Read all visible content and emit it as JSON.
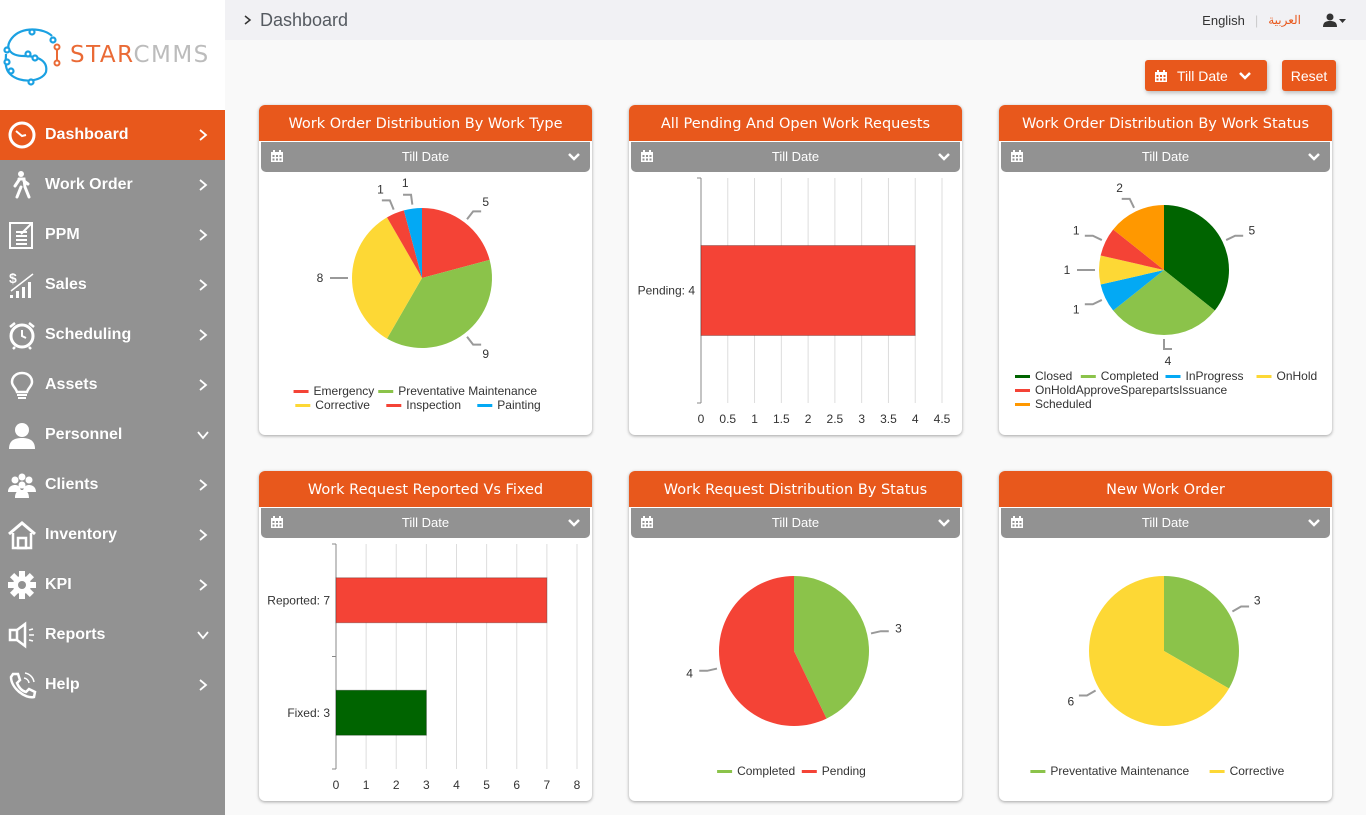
{
  "app": {
    "logo_primary": "STAR",
    "logo_secondary": "CMMS",
    "colors": {
      "brand": "#e8581c",
      "sidebar": "#929292",
      "logo_blue": "#1ba1e2"
    }
  },
  "sidebar": {
    "items": [
      {
        "label": "Dashboard",
        "icon": "clock-icon",
        "chevron": "right",
        "active": true
      },
      {
        "label": "Work Order",
        "icon": "walking-person-icon",
        "chevron": "right"
      },
      {
        "label": "PPM",
        "icon": "checklist-document-icon",
        "chevron": "right"
      },
      {
        "label": "Sales",
        "icon": "dollar-growth-icon",
        "chevron": "right"
      },
      {
        "label": "Scheduling",
        "icon": "alarm-clock-icon",
        "chevron": "right"
      },
      {
        "label": "Assets",
        "icon": "lightbulb-icon",
        "chevron": "right"
      },
      {
        "label": "Personnel",
        "icon": "user-icon",
        "chevron": "down"
      },
      {
        "label": "Clients",
        "icon": "users-group-icon",
        "chevron": "right"
      },
      {
        "label": "Inventory",
        "icon": "home-icon",
        "chevron": "right"
      },
      {
        "label": "KPI",
        "icon": "gear-icon",
        "chevron": "right"
      },
      {
        "label": "Reports",
        "icon": "megaphone-icon",
        "chevron": "down"
      },
      {
        "label": "Help",
        "icon": "phone-icon",
        "chevron": "right"
      }
    ]
  },
  "header": {
    "breadcrumb": "Dashboard",
    "lang_english": "English",
    "lang_arabic": "العربية"
  },
  "filters": {
    "date_range": "Till Date",
    "reset_label": "Reset"
  },
  "cards": [
    {
      "title": "Work Order Distribution By Work Type",
      "filter": "Till Date"
    },
    {
      "title": "All Pending And Open Work Requests",
      "filter": "Till Date"
    },
    {
      "title": "Work Order Distribution By Work Status",
      "filter": "Till Date"
    },
    {
      "title": "Work Request Reported Vs Fixed",
      "filter": "Till Date"
    },
    {
      "title": "Work Request Distribution By Status",
      "filter": "Till Date"
    },
    {
      "title": "New Work Order",
      "filter": "Till Date"
    }
  ],
  "chart_data": [
    {
      "type": "pie",
      "title": "Work Order Distribution By Work Type",
      "categories": [
        "Emergency",
        "Preventative Maintenance",
        "Corrective",
        "Inspection",
        "Painting"
      ],
      "values": [
        5,
        9,
        8,
        1,
        1
      ],
      "colors": [
        "#f44336",
        "#8bc34a",
        "#fdd835",
        "#f44336",
        "#03a9f4"
      ],
      "legend": "bottom"
    },
    {
      "type": "bar",
      "orientation": "horizontal",
      "title": "All Pending And Open Work Requests",
      "categories": [
        "Pending: 4"
      ],
      "values": [
        4
      ],
      "colors": [
        "#f44336"
      ],
      "xlim": [
        0,
        4.5
      ],
      "xticks": [
        "0",
        "0.5",
        "1",
        "1.5",
        "2",
        "2.5",
        "3",
        "3.5",
        "4",
        "4.5"
      ],
      "grid": true
    },
    {
      "type": "pie",
      "title": "Work Order Distribution By Work Status",
      "categories": [
        "Closed",
        "Completed",
        "InProgress",
        "OnHold",
        "OnHoldApproveSparepartsIssuance",
        "Scheduled"
      ],
      "values": [
        5,
        4,
        1,
        1,
        1,
        2
      ],
      "colors": [
        "#006400",
        "#8bc34a",
        "#03a9f4",
        "#fdd835",
        "#f44336",
        "#ff9800"
      ],
      "legend": "bottom"
    },
    {
      "type": "bar",
      "orientation": "horizontal",
      "title": "Work Request Reported Vs Fixed",
      "categories": [
        "Reported: 7",
        "Fixed: 3"
      ],
      "values": [
        7,
        3
      ],
      "colors": [
        "#f44336",
        "#006400"
      ],
      "xlim": [
        0,
        8
      ],
      "xticks": [
        "0",
        "1",
        "2",
        "3",
        "4",
        "5",
        "6",
        "7",
        "8"
      ],
      "grid": true
    },
    {
      "type": "pie",
      "title": "Work Request Distribution By Status",
      "categories": [
        "Completed",
        "Pending"
      ],
      "values": [
        3,
        4
      ],
      "colors": [
        "#8bc34a",
        "#f44336"
      ],
      "legend": "bottom"
    },
    {
      "type": "pie",
      "title": "New Work Order",
      "categories": [
        "Preventative Maintenance",
        "Corrective"
      ],
      "values": [
        3,
        6
      ],
      "colors": [
        "#8bc34a",
        "#fdd835"
      ],
      "legend": "bottom"
    }
  ]
}
